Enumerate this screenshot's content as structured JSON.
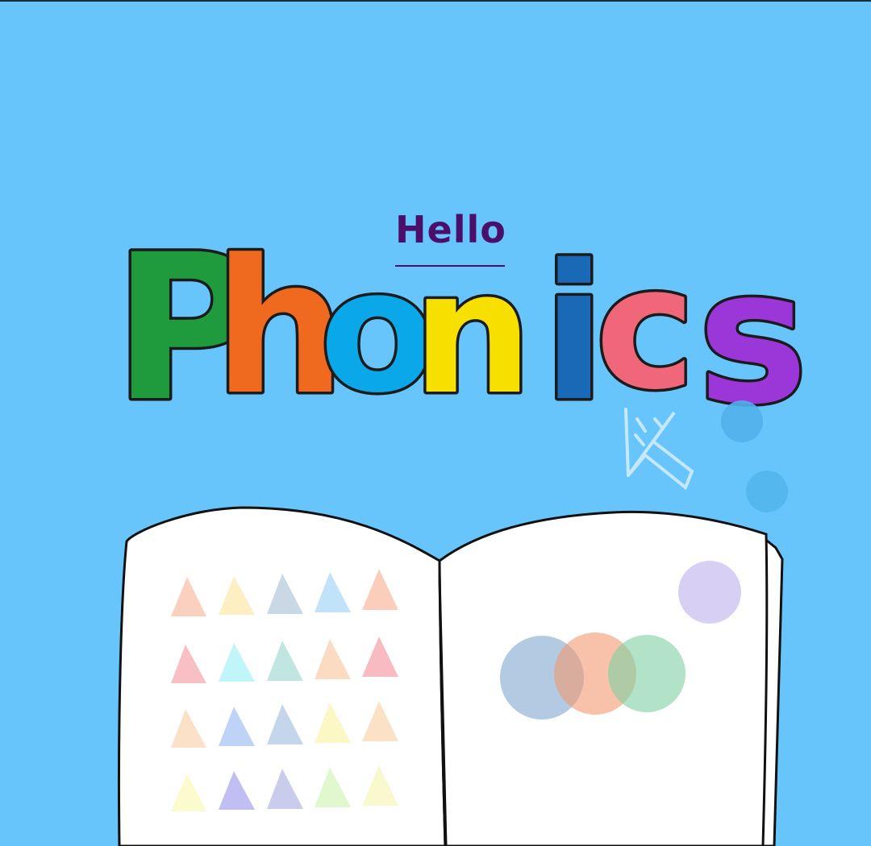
{
  "hello": "Hello",
  "title_letters": [
    {
      "char": "P",
      "color": "#1f9b3e"
    },
    {
      "char": "h",
      "color": "#ef6a1f"
    },
    {
      "char": "o",
      "color": "#0aa8e8"
    },
    {
      "char": "n",
      "color": "#f7e000"
    },
    {
      "char": "i",
      "color": "#1a69b6"
    },
    {
      "char": "c",
      "color": "#f0677a"
    },
    {
      "char": "s",
      "color": "#9b36d9"
    }
  ],
  "colors": {
    "background": "#67c5fc",
    "hello_text": "#4a0f6b",
    "book_page": "#ffffff"
  },
  "icons": [
    "pointer-arrow-icon",
    "open-book-illustration"
  ]
}
